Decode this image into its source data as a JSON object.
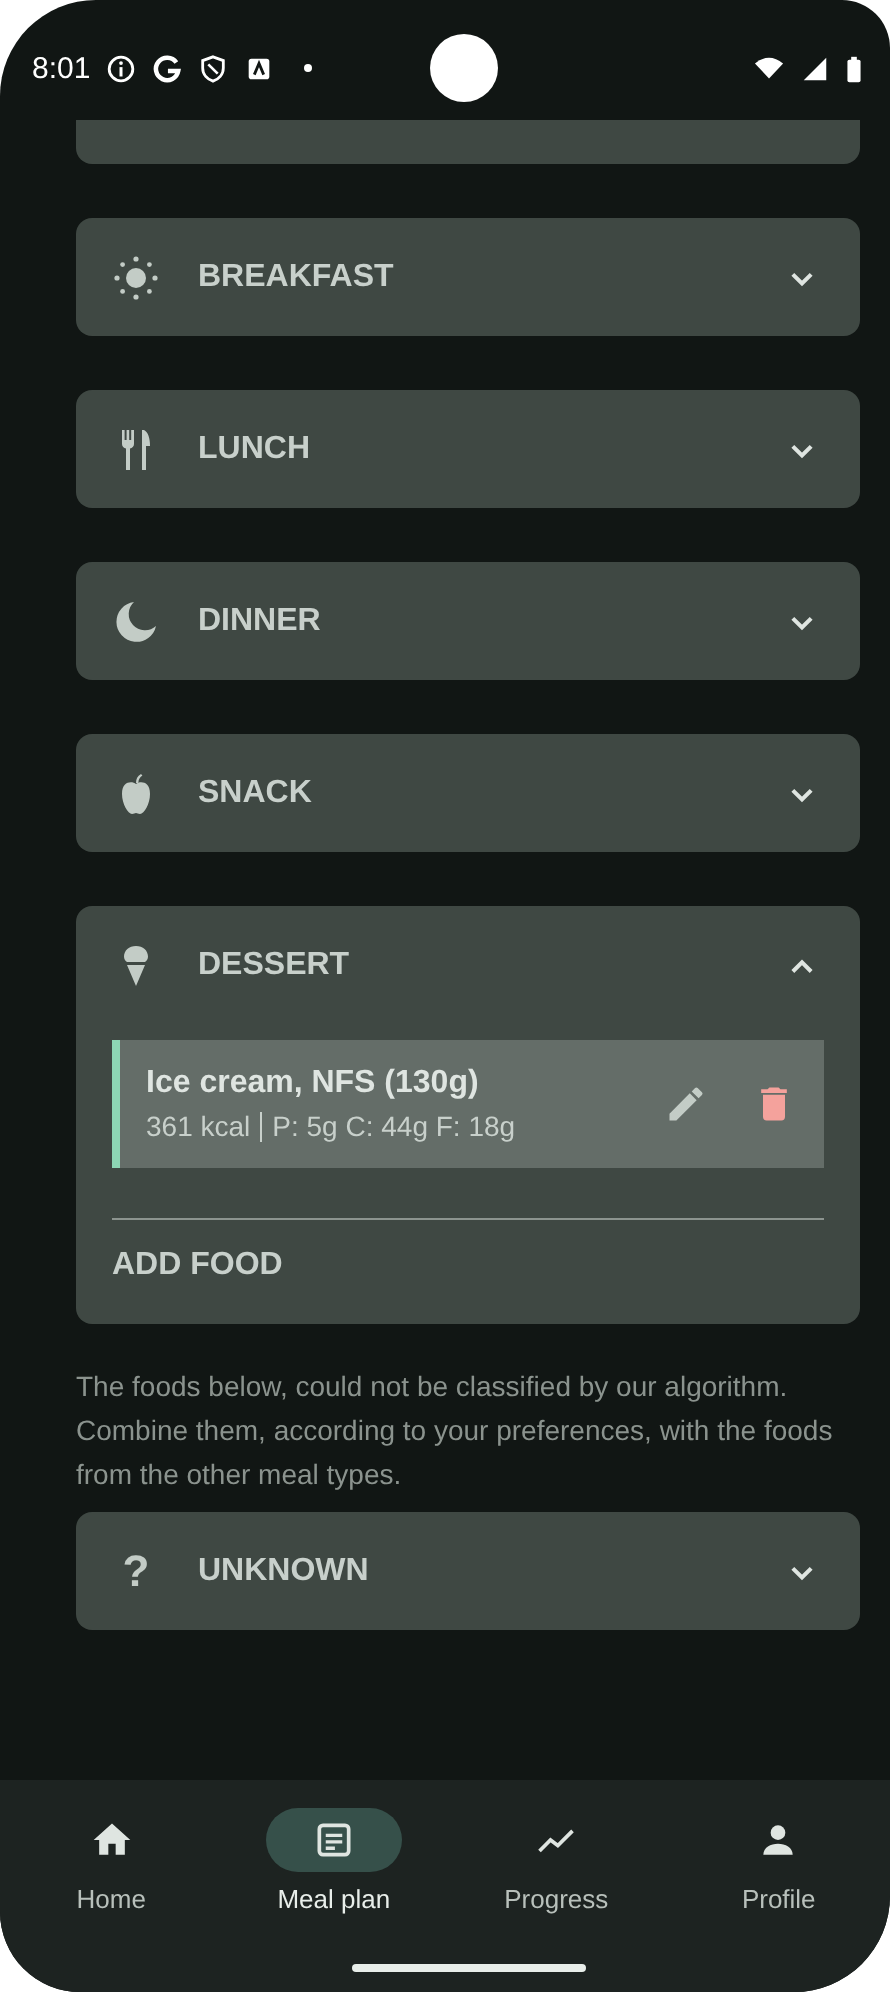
{
  "status_bar": {
    "time": "8:01"
  },
  "meals": [
    {
      "kind": "breakfast",
      "label": "BREAKFAST",
      "expanded": false
    },
    {
      "kind": "lunch",
      "label": "LUNCH",
      "expanded": false
    },
    {
      "kind": "dinner",
      "label": "DINNER",
      "expanded": false
    },
    {
      "kind": "snack",
      "label": "SNACK",
      "expanded": false
    },
    {
      "kind": "dessert",
      "label": "DESSERT",
      "expanded": true,
      "foods": [
        {
          "name": "Ice cream, NFS (130g)",
          "kcal": "361 kcal",
          "macros": "P: 5g C: 44g F: 18g"
        }
      ],
      "add_label": "ADD FOOD"
    }
  ],
  "note": "The foods below, could not be classified by our algorithm. Combine them, according to your preferences, with the foods from the other meal types.",
  "unknown_meal": {
    "kind": "unknown",
    "icon_text": "?",
    "label": "UNKNOWN",
    "expanded": false
  },
  "nav": [
    {
      "kind": "home",
      "label": "Home",
      "selected": false
    },
    {
      "kind": "plan",
      "label": "Meal plan",
      "selected": true
    },
    {
      "kind": "progress",
      "label": "Progress",
      "selected": false
    },
    {
      "kind": "profile",
      "label": "Profile",
      "selected": false
    }
  ]
}
